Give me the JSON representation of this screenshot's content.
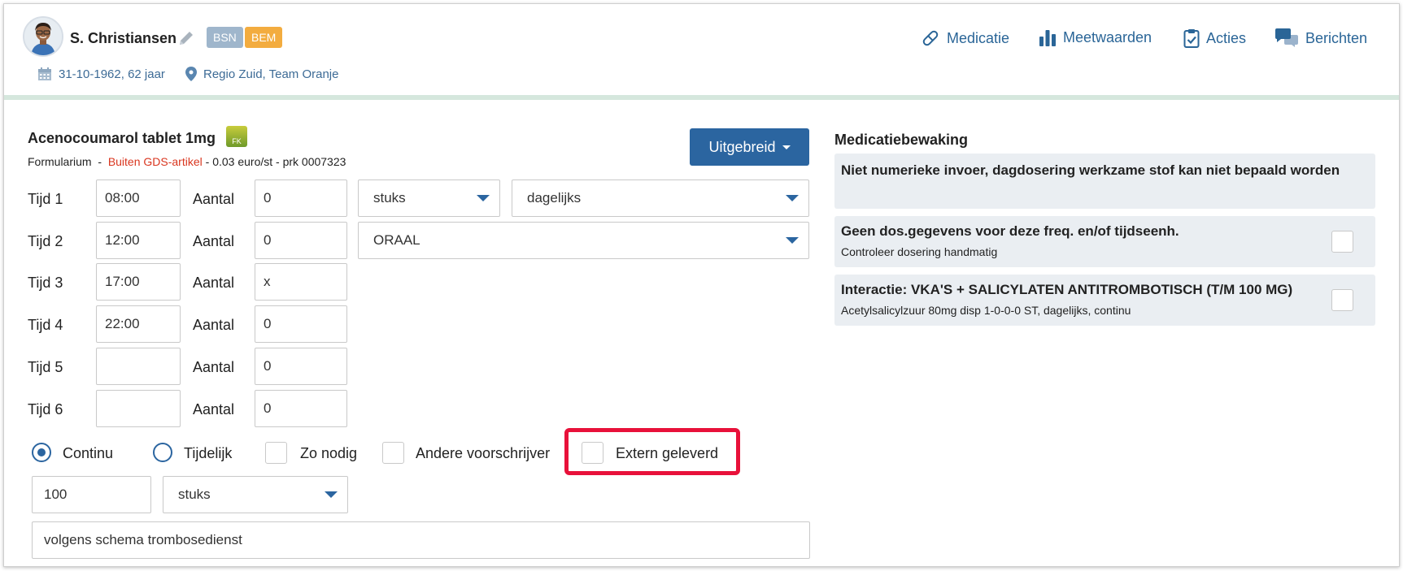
{
  "patient": {
    "name": "S. Christiansen",
    "badges": [
      "BSN",
      "BEM"
    ],
    "dob": "31-10-1962, 62 jaar",
    "region": "Regio Zuid, Team Oranje"
  },
  "nav": {
    "medicatie": "Medicatie",
    "meetwaarden": "Meetwaarden",
    "acties": "Acties",
    "berichten": "Berichten"
  },
  "drug": {
    "name": "Acenocoumarol tablet 1mg",
    "fk_badge": "FK",
    "formularium": "Formularium",
    "sep": "-",
    "gds": "Buiten GDS-artikel",
    "price": "- 0.03 euro/st - prk 0007323",
    "uitgebreid_label": "Uitgebreid"
  },
  "schedule": {
    "aantal_label": "Aantal",
    "rows": [
      {
        "label": "Tijd 1",
        "time": "08:00",
        "amount": "0"
      },
      {
        "label": "Tijd 2",
        "time": "12:00",
        "amount": "0"
      },
      {
        "label": "Tijd 3",
        "time": "17:00",
        "amount": "x"
      },
      {
        "label": "Tijd 4",
        "time": "22:00",
        "amount": "0"
      },
      {
        "label": "Tijd 5",
        "time": "",
        "amount": "0"
      },
      {
        "label": "Tijd 6",
        "time": "",
        "amount": "0"
      }
    ],
    "unit": "stuks",
    "frequency": "dagelijks",
    "route": "ORAAL"
  },
  "options": {
    "continu": "Continu",
    "tijdelijk": "Tijdelijk",
    "zo_nodig": "Zo nodig",
    "andere_voorschrijver": "Andere voorschrijver",
    "extern_geleverd": "Extern geleverd"
  },
  "quantity": {
    "value": "100",
    "unit": "stuks"
  },
  "instruction": "volgens schema trombosedienst",
  "medicatiebewaking": {
    "title": "Medicatiebewaking",
    "items": [
      {
        "title": "Niet numerieke invoer, dagdosering werkzame stof kan niet bepaald worden",
        "sub": ""
      },
      {
        "title": "Geen dos.gegevens voor deze freq. en/of tijdseenh.",
        "sub": "Controleer dosering handmatig"
      },
      {
        "title": "Interactie: VKA'S + SALICYLATEN ANTITROMBOTISCH (T/M 100 MG)",
        "sub": "Acetylsalicylzuur 80mg disp 1-0-0-0 ST, dagelijks, continu"
      }
    ]
  },
  "colors": {
    "primary": "#2b65a0",
    "link": "#2a6597",
    "warning": "#d9361f",
    "highlight": "#e8113a",
    "badge_bsn": "#9fb6cc",
    "badge_bem": "#f3ac3f"
  }
}
